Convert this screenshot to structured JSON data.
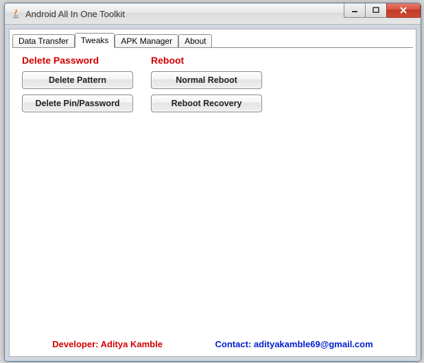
{
  "window": {
    "title": "Android All In One Toolkit"
  },
  "tabs": [
    {
      "label": "Data Transfer"
    },
    {
      "label": "Tweaks"
    },
    {
      "label": "APK Manager"
    },
    {
      "label": "About"
    }
  ],
  "active_tab_index": 1,
  "tweaks": {
    "delete_password_header": "Delete Password",
    "reboot_header": "Reboot",
    "delete_pattern_btn": "Delete Pattern",
    "delete_pin_btn": "Delete Pin/Password",
    "normal_reboot_btn": "Normal Reboot",
    "reboot_recovery_btn": "Reboot Recovery"
  },
  "footer": {
    "developer": "Developer: Aditya Kamble",
    "contact": "Contact: adityakamble69@gmail.com"
  }
}
